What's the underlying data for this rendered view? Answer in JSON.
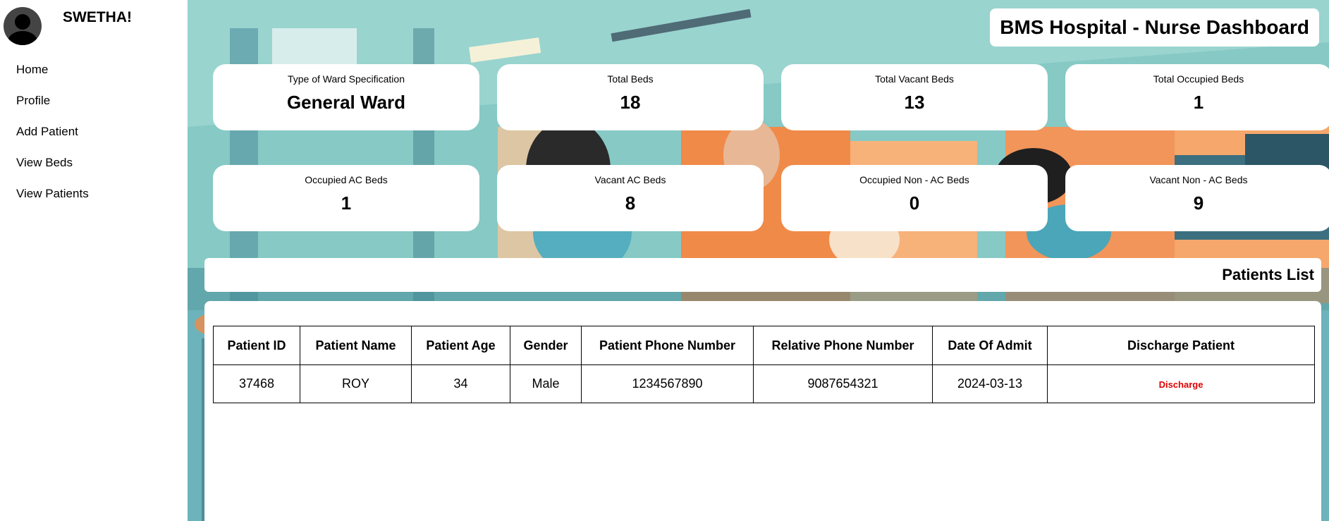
{
  "user": {
    "name": "SWETHA!"
  },
  "sidebar": {
    "items": [
      {
        "label": "Home"
      },
      {
        "label": "Profile"
      },
      {
        "label": "Add Patient"
      },
      {
        "label": "View Beds"
      },
      {
        "label": "View Patients"
      }
    ]
  },
  "header": {
    "title": "BMS Hospital - Nurse Dashboard"
  },
  "stats": [
    {
      "label": "Type of Ward Specification",
      "value": "General Ward"
    },
    {
      "label": "Total Beds",
      "value": "18"
    },
    {
      "label": "Total Vacant Beds",
      "value": "13"
    },
    {
      "label": "Total Occupied Beds",
      "value": "1"
    },
    {
      "label": "Occupied AC Beds",
      "value": "1"
    },
    {
      "label": "Vacant AC Beds",
      "value": "8"
    },
    {
      "label": "Occupied Non - AC Beds",
      "value": "0"
    },
    {
      "label": "Vacant Non - AC Beds",
      "value": "9"
    }
  ],
  "patients_list": {
    "title": "Patients List",
    "columns": [
      "Patient ID",
      "Patient Name",
      "Patient Age",
      "Gender",
      "Patient Phone Number",
      "Relative Phone Number",
      "Date Of Admit",
      "Discharge Patient"
    ],
    "rows": [
      {
        "id": "37468",
        "name": "ROY",
        "age": "34",
        "gender": "Male",
        "phone": "1234567890",
        "relative_phone": "9087654321",
        "admit_date": "2024-03-13",
        "action": "Discharge"
      }
    ]
  },
  "colors": {
    "discharge": "#e00000",
    "background_teal": "#8ccbc6",
    "accent_orange": "#f08a48"
  }
}
